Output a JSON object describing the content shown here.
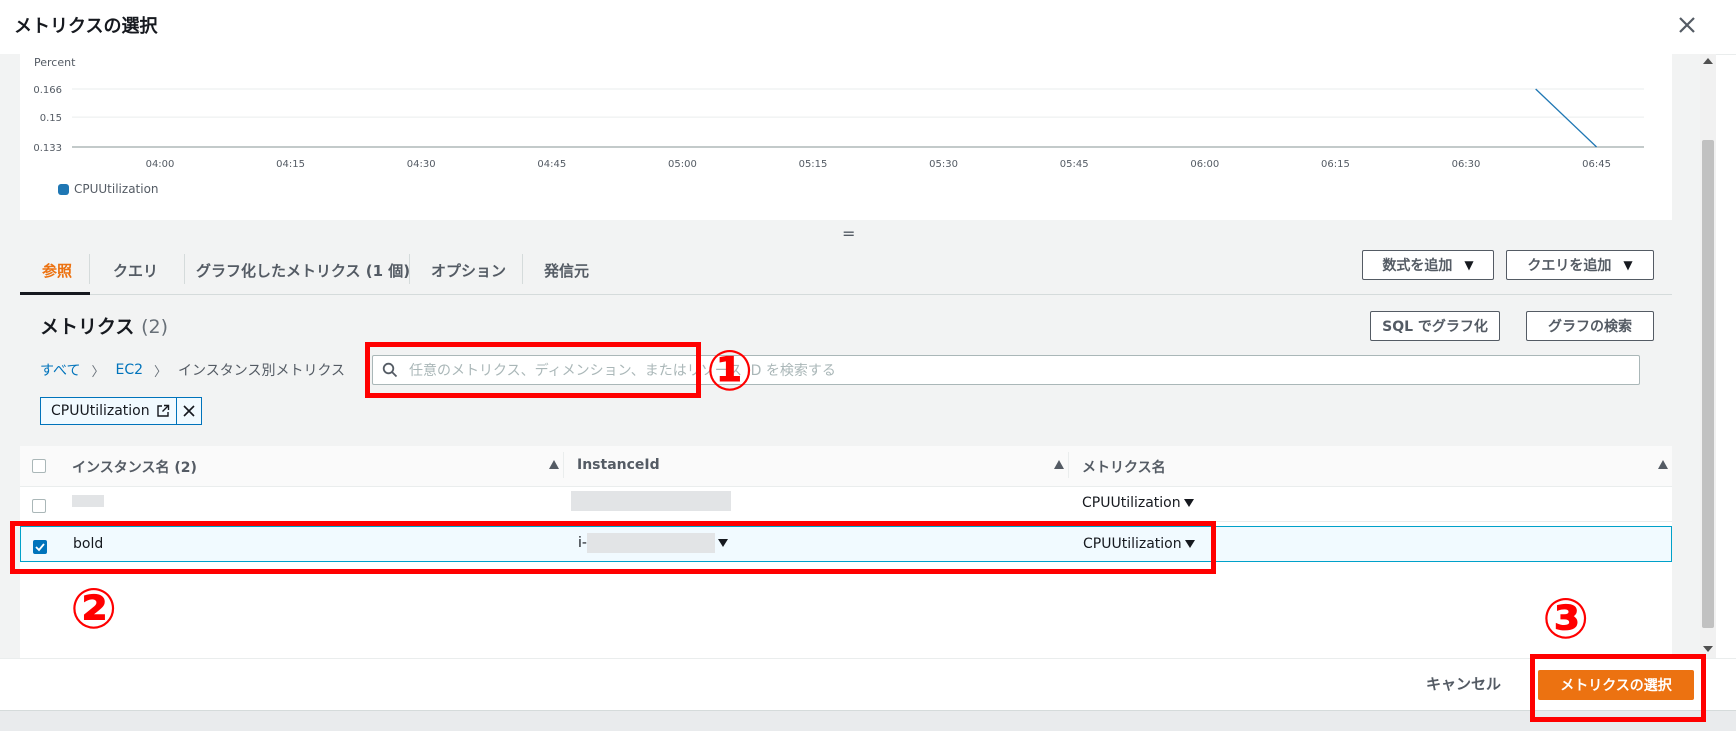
{
  "modal": {
    "title": "メトリクスの選択",
    "close_icon": "close-icon"
  },
  "chart_data": {
    "type": "line",
    "ylabel": "Percent",
    "yticks": [
      "0.166",
      "0.15",
      "0.133"
    ],
    "ylim": [
      0.133,
      0.166
    ],
    "x": [
      "04:00",
      "04:15",
      "04:30",
      "04:45",
      "05:00",
      "05:15",
      "05:30",
      "05:45",
      "06:00",
      "06:15",
      "06:30",
      "06:45"
    ],
    "series": [
      {
        "name": "CPUUtilization",
        "color": "#1f77b4",
        "points": [
          {
            "x": "06:38",
            "y": 0.166
          },
          {
            "x": "06:45",
            "y": 0.133
          }
        ]
      }
    ],
    "legend": "bottom-left",
    "grid": true
  },
  "tabs": [
    {
      "label": "参照",
      "active": true
    },
    {
      "label": "クエリ",
      "active": false
    },
    {
      "label": "グラフ化したメトリクス (1 個)",
      "active": false
    },
    {
      "label": "オプション",
      "active": false
    },
    {
      "label": "発信元",
      "active": false
    }
  ],
  "toolbar": {
    "add_math_label": "数式を追加",
    "add_query_label": "クエリを追加",
    "sql_graph_label": "SQL でグラフ化",
    "graph_search_label": "グラフの検索"
  },
  "metrics": {
    "title": "メトリクス",
    "count": "(2)"
  },
  "breadcrumb": {
    "all": "すべて",
    "ec2": "EC2",
    "current": "インスタンス別メトリクス"
  },
  "search": {
    "placeholder": "任意のメトリクス、ディメンション、またはリソース ID を検索する"
  },
  "filter_token": {
    "label": "CPUUtilization"
  },
  "table": {
    "headers": {
      "instance_name": "インスタンス名 (2)",
      "instance_id": "InstanceId",
      "metric_name": "メトリクス名"
    },
    "rows": [
      {
        "instance_name": "",
        "instance_id": "",
        "metric_name": "CPUUtilization",
        "selected": false
      },
      {
        "instance_name": "bold",
        "instance_id": "i-",
        "metric_name": "CPUUtilization",
        "selected": true
      }
    ]
  },
  "footer": {
    "cancel_label": "キャンセル",
    "select_label": "メトリクスの選択"
  },
  "annotations": {
    "one": "①",
    "two": "②",
    "three": "③",
    "color": "#ff0000"
  },
  "colors": {
    "accent": "#ec7211",
    "link": "#0073bb",
    "series": "#1f77b4"
  }
}
